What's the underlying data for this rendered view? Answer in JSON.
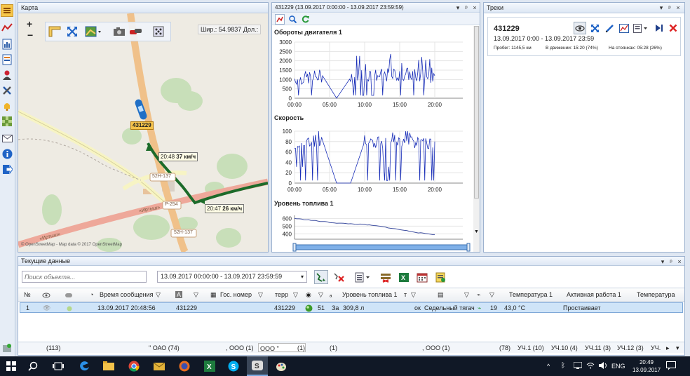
{
  "map": {
    "title": "Карта",
    "coords": "Шир.: 54.9837  Дол.:",
    "attribution": "© OpenStreetMap - Map data © 2017 OpenStreetMap",
    "vehicle_label": "431229",
    "speed_tag_1": {
      "time": "20:48",
      "speed": "37 км/ч"
    },
    "speed_tag_2": {
      "time": "20:47",
      "speed": "26 км/ч"
    },
    "road_labels": [
      "52Н-137",
      "Р-254",
      "52Н-137",
      "«Иртыш»",
      "«Иртыш»"
    ]
  },
  "charts_panel": {
    "title": "431229 (13.09.2017 0:00:00 - 13.09.2017 23:59:59)"
  },
  "chart_data": [
    {
      "type": "line",
      "title": "Обороты двигателя 1",
      "x": [
        "00:00",
        "02:00",
        "04:00",
        "06:00",
        "08:00",
        "10:00",
        "12:00",
        "14:00",
        "16:00",
        "18:00",
        "20:00"
      ],
      "series": [
        {
          "values": [
            1050,
            1100,
            1200,
            0,
            1100,
            1300,
            1200,
            1250,
            1300,
            1150,
            1200
          ]
        }
      ],
      "xticks": [
        "00:00",
        "05:00",
        "10:00",
        "15:00",
        "20:00"
      ],
      "yticks": [
        0,
        500,
        1000,
        1500,
        2000,
        2500,
        3000
      ],
      "ylim": [
        0,
        3000
      ],
      "line_color": "#1a2fb8"
    },
    {
      "type": "line",
      "title": "Скорость",
      "x": [
        "00:00",
        "02:00",
        "04:00",
        "06:00",
        "08:00",
        "10:00",
        "12:00",
        "14:00",
        "16:00",
        "18:00",
        "20:00"
      ],
      "series": [
        {
          "values": [
            78,
            80,
            82,
            0,
            0,
            80,
            78,
            82,
            80,
            75,
            80
          ]
        }
      ],
      "xticks": [
        "00:00",
        "05:00",
        "10:00",
        "15:00",
        "20:00"
      ],
      "yticks": [
        0,
        20,
        40,
        60,
        80,
        100
      ],
      "ylim": [
        0,
        100
      ],
      "line_color": "#1a2fb8"
    },
    {
      "type": "line",
      "title": "Уровень топлива 1",
      "x": [
        "00:00",
        "02:00",
        "04:00",
        "06:00",
        "08:00",
        "10:00",
        "12:00",
        "14:00",
        "16:00",
        "18:00",
        "20:00"
      ],
      "series": [
        {
          "values": [
            600,
            580,
            560,
            540,
            530,
            520,
            500,
            470,
            440,
            410,
            390
          ]
        }
      ],
      "yticks": [
        400,
        500,
        600
      ],
      "ylim": [
        330,
        640
      ],
      "line_color": "#3f4fa0"
    }
  ],
  "tracks": {
    "title": "Треки",
    "vehicle": "431229",
    "period": "13.09.2017 0:00 - 13.09.2017 23:59",
    "mileage": "Пробег: 1145,5 км",
    "moving": "В движении: 15:20 (74%)",
    "parked": "На стоянках: 05:28 (26%)"
  },
  "current": {
    "title": "Текущие данные",
    "search_placeholder": "Поиск объекта...",
    "period": "13.09.2017 00:00:00 - 13.09.2017 23:59:59",
    "columns": [
      "№",
      "Время сообщения",
      "Гос. номер",
      "терр",
      "Уровень топлива 1",
      "т",
      "Температура 1",
      "Активная работа 1",
      "Температура"
    ],
    "row": {
      "num": "1",
      "time": "13.09.2017 20:48:56",
      "plate": "431229",
      "term": "431229",
      "sat": "51",
      "za": "За",
      "fuel": "309,8 л",
      "ok": "ок",
      "type": "Седельный тягач",
      "signal": "19",
      "temp": "43,0 °C",
      "active": "Простаивает"
    },
    "status_groups": [
      "(113)",
      "\" ОАО (74)",
      ", ООО (1)",
      "ООО \"",
      "(1)",
      "(1)",
      ", ООО (1)",
      "(78)",
      "УЧ.1 (10)",
      "УЧ.10 (4)",
      "УЧ.11 (3)",
      "УЧ.12 (3)",
      "УЧ."
    ]
  },
  "taskbar": {
    "time": "20:49",
    "date": "13.09.2017",
    "lang": "ENG"
  }
}
